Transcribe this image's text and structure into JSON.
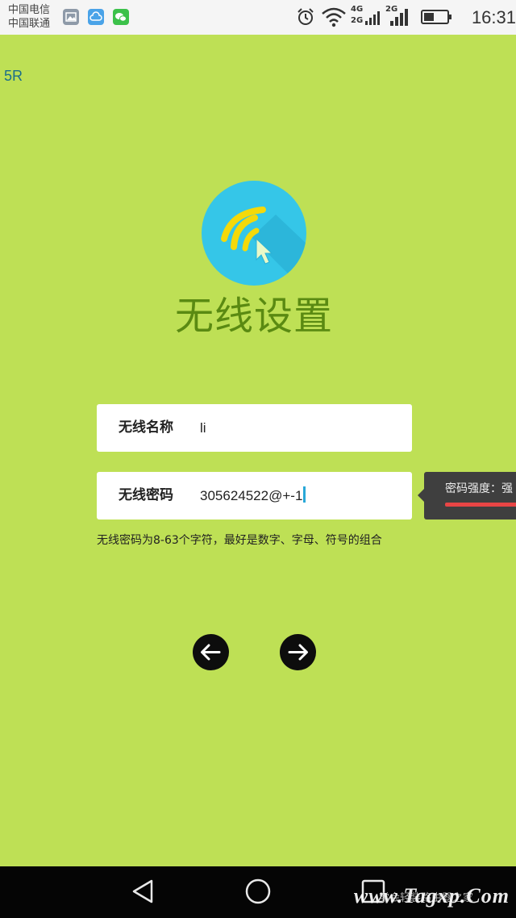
{
  "statusbar": {
    "carrier_1": "中国电信",
    "carrier_2": "中国联通",
    "net_4g": "4G",
    "net_2g_a": "2G",
    "net_2g_b": "2G",
    "time": "16:31",
    "icons": [
      "gallery-icon",
      "cloud-icon",
      "wechat-icon",
      "alarm-icon",
      "wifi-icon",
      "signal-icon",
      "battery-icon"
    ]
  },
  "corner_tag": "5R",
  "page": {
    "title": "无线设置",
    "ssid_label": "无线名称",
    "ssid_value": "li",
    "password_label": "无线密码",
    "password_value": "305624522@+-1",
    "hint": "无线密码为8-63个字符，最好是数字、字母、符号的组合",
    "strength_tooltip": "密码强度：强"
  },
  "colors": {
    "background": "#bee055",
    "title": "#5a8a12",
    "logo": "#35c6e8",
    "logo_wave": "#f4d90a",
    "strength_bar": "#e84545"
  },
  "navbar": {
    "icons": [
      "back-icon",
      "home-icon",
      "recents-icon"
    ],
    "watermark": "www.Tagxp.Com",
    "watermark_sub": "学会轻装路由器之家"
  }
}
